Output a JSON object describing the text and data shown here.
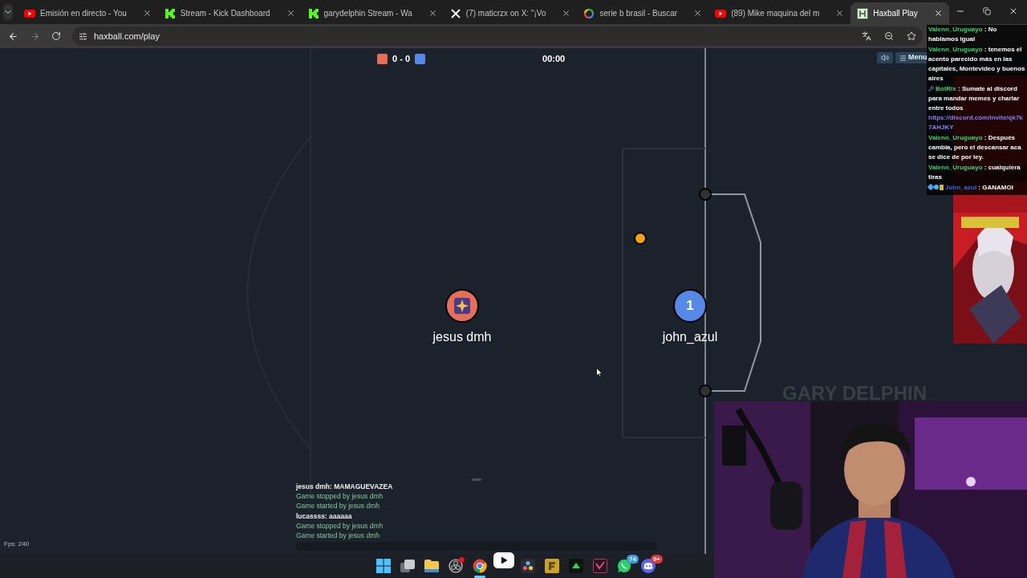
{
  "browser": {
    "tabs": [
      {
        "title": "Emisión en directo - You",
        "kind": "youtube",
        "selected": false
      },
      {
        "title": "Stream - Kick Dashboard",
        "kind": "kick",
        "selected": false
      },
      {
        "title": "garydelphin Stream - Wa",
        "kind": "kick",
        "selected": false
      },
      {
        "title": "(7) maticrzx on X: \"¡Vo",
        "kind": "x",
        "selected": false
      },
      {
        "title": "serie b brasil - Buscar",
        "kind": "google",
        "selected": false
      },
      {
        "title": "(89) Mike maquina del m",
        "kind": "youtube",
        "selected": false
      },
      {
        "title": "Haxball Play",
        "kind": "haxball",
        "selected": true
      }
    ],
    "address": "haxball.com/play"
  },
  "game": {
    "score": "0 - 0",
    "time": "00:00",
    "menu_label": "Menu",
    "players": [
      {
        "name": "jesus dmh",
        "color": "#e56e56",
        "kind": "icon"
      },
      {
        "name": "john_azul",
        "color": "#5689e5",
        "kind": "number",
        "number": "1"
      }
    ],
    "fps": "Fps: 240",
    "log": [
      {
        "kind": "chat",
        "text": "jesus dmh: MAMAGUEVAZEA"
      },
      {
        "kind": "system",
        "text": "Game stopped by jesus dmh"
      },
      {
        "kind": "system",
        "text": "Game started by jesus dmh"
      },
      {
        "kind": "chat",
        "text": "lucassss: aaaaaa"
      },
      {
        "kind": "system",
        "text": "Game stopped by jesus dmh"
      },
      {
        "kind": "system",
        "text": "Game started by jesus dmh"
      }
    ]
  },
  "stream": {
    "brand": "GARY DELPHIN",
    "chat": [
      {
        "kind": "plain",
        "name": "Valenn_Uruguayo",
        "color": "#3fd46b",
        "separator": ":",
        "text": "No hablamos igual"
      },
      {
        "kind": "plain",
        "name": "Valenn_Uruguayo",
        "color": "#3fd46b",
        "separator": ":",
        "text": "tenemos el acento parecido más en las capitales, Montevideo y buenos aires"
      },
      {
        "kind": "bot",
        "name": "BotRix",
        "color": "#3fd46b",
        "separator": ":",
        "text": "Sumate al discord para mandar memes y charlar entre todos",
        "link": "https://discord.com/invite/qk7k7AHJKY"
      },
      {
        "kind": "plain",
        "name": "Valenn_Uruguayo",
        "color": "#3fd46b",
        "separator": ":",
        "text": "Después cambia, pero el descansar aca se dice de por ley."
      },
      {
        "kind": "plain",
        "name": "Valenn_Uruguayo",
        "color": "#3fd46b",
        "separator": ":",
        "text": "cualquiera tiras"
      },
      {
        "kind": "badged",
        "name": "John_azul",
        "color": "#2f6fe0",
        "separator": ":",
        "text": "GANAMOI"
      }
    ]
  },
  "taskbar": {
    "apps": [
      {
        "kind": "windows",
        "selected": false
      },
      {
        "kind": "taskview",
        "selected": false
      },
      {
        "kind": "folder",
        "selected": false
      },
      {
        "kind": "obs",
        "selected": false,
        "alert": true
      },
      {
        "kind": "chrome",
        "selected": true
      },
      {
        "kind": "play",
        "selected": false
      },
      {
        "kind": "davinci",
        "selected": false
      },
      {
        "kind": "gold",
        "selected": false
      },
      {
        "kind": "green",
        "selected": false
      },
      {
        "kind": "editor",
        "selected": false
      },
      {
        "kind": "whatsapp",
        "selected": false,
        "badge": "74"
      },
      {
        "kind": "discord",
        "selected": false,
        "badge": "9+"
      }
    ]
  }
}
